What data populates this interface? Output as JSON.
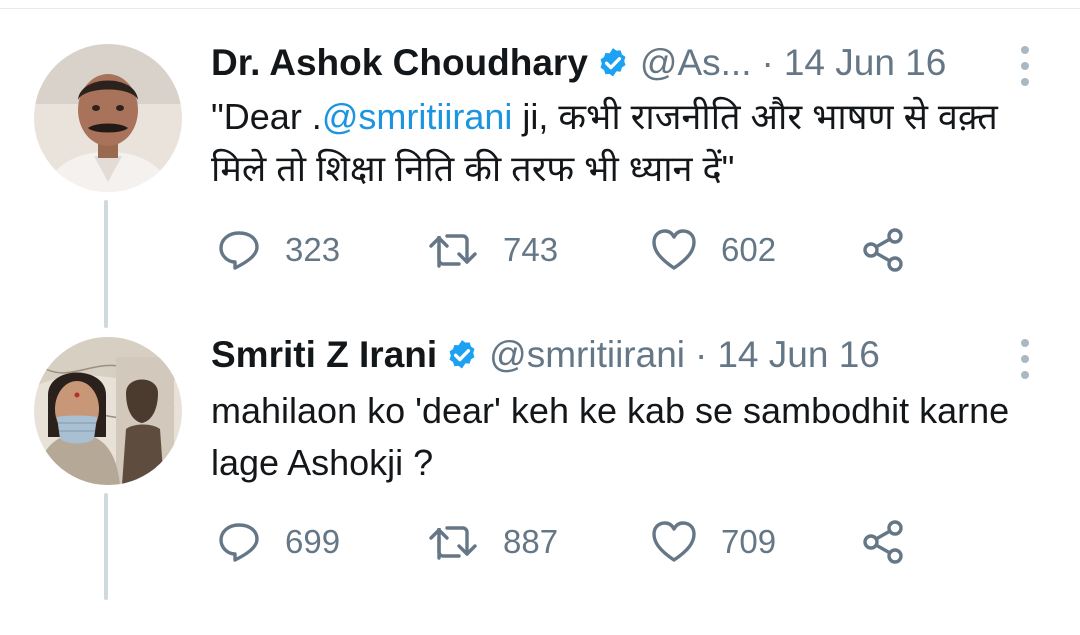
{
  "tweets": [
    {
      "name": "Dr. Ashok Choudhary",
      "handle": "@As...",
      "separator": "·",
      "date": "14 Jun 16",
      "text_before": "\"Dear .",
      "mention": "@smritiirani",
      "text_after": " ji, कभी राजनीति और भाषण से वक़्त मिले तो शिक्षा निति की तरफ भी ध्यान दें\"",
      "replies": "323",
      "retweets": "743",
      "likes": "602",
      "avatar_icon": "user-avatar-icon"
    },
    {
      "name": "Smriti Z Irani",
      "handle": "@smritiirani",
      "separator": "·",
      "date": "14 Jun 16",
      "text": "mahilaon ko 'dear' keh ke kab se sambodhit karne lage Ashokji ?",
      "replies": "699",
      "retweets": "887",
      "likes": "709",
      "avatar_icon": "user-avatar-icon"
    }
  ],
  "colors": {
    "accent": "#1b95e0",
    "verified": "#1da1f2",
    "secondary_text": "#657786",
    "thread_line": "#cfd9de"
  },
  "icons": [
    "verified-badge-icon",
    "more-options-icon",
    "reply-icon",
    "retweet-icon",
    "like-icon",
    "share-icon"
  ]
}
